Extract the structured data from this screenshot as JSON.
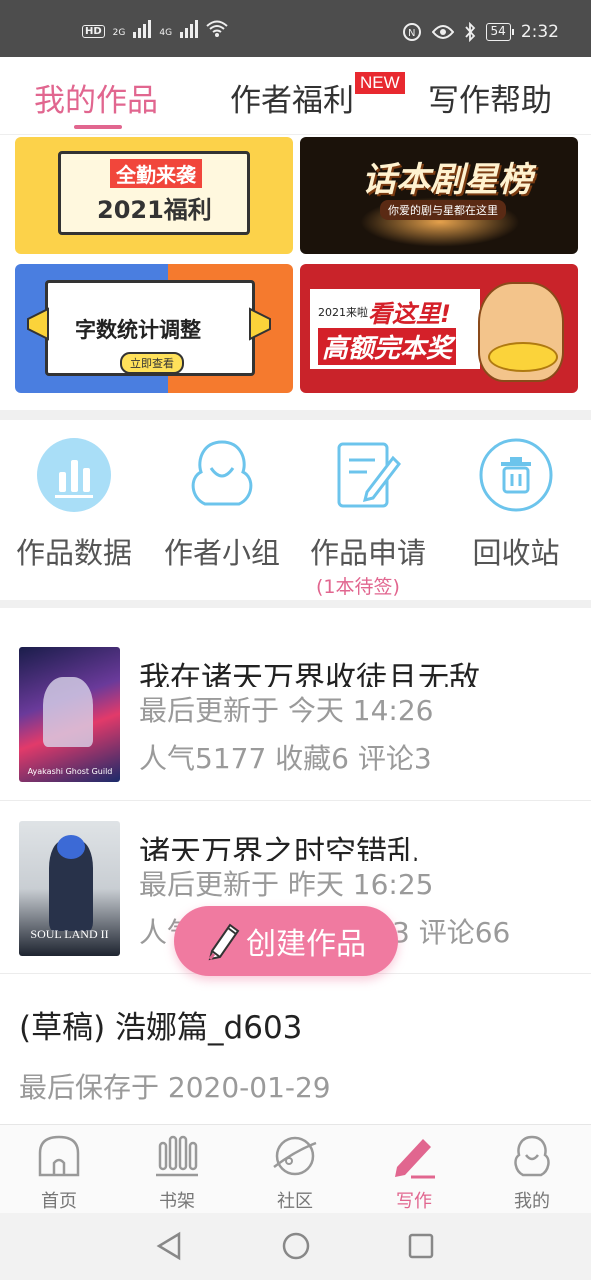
{
  "status_bar": {
    "hd_label": "HD",
    "net1": "2G",
    "net2": "4G",
    "battery": "54",
    "time": "2:32"
  },
  "top_tabs": {
    "tabs": [
      {
        "label": "我的作品"
      },
      {
        "label": "作者福利"
      },
      {
        "label": "写作帮助"
      }
    ],
    "new_badge": "NEW"
  },
  "banners": {
    "b1": {
      "line1": "全勤来袭",
      "line2": "2021福利"
    },
    "b2": {
      "title": "话本剧星榜",
      "subtitle": "你爱的剧与星都在这里"
    },
    "b3": {
      "title": "字数统计调整",
      "button": "立即查看"
    },
    "b4": {
      "tag": "2021来啦",
      "line1": "看这里!",
      "line2": "高额完本奖"
    }
  },
  "quick_actions": [
    {
      "label": "作品数据"
    },
    {
      "label": "作者小组"
    },
    {
      "label": "作品申请"
    },
    {
      "label": "回收站"
    }
  ],
  "pending_note": "(1本待签)",
  "works": [
    {
      "title": "我在诸天万界收徒且无敌",
      "updated": "最后更新于 今天 14:26",
      "stats": "人气5177 收藏6 评论3",
      "cover_caption": "Ayakashi Ghost Guild"
    },
    {
      "title": "诸天万界之时空错乱",
      "updated": "最后更新于 昨天 16:25",
      "stats_left": "人气",
      "stats_right": "3 评论66",
      "cover_caption": "SOUL LAND II"
    }
  ],
  "draft": {
    "title": "(草稿) 浩娜篇_d603",
    "saved": "最后保存于 2020-01-29"
  },
  "fab": {
    "label": "创建作品"
  },
  "bottom_nav": [
    {
      "label": "首页"
    },
    {
      "label": "书架"
    },
    {
      "label": "社区"
    },
    {
      "label": "写作"
    },
    {
      "label": "我的"
    }
  ],
  "colors": {
    "accent": "#e1668f",
    "fab": "#f07aa0",
    "icon_blue": "#6cc4ec"
  }
}
